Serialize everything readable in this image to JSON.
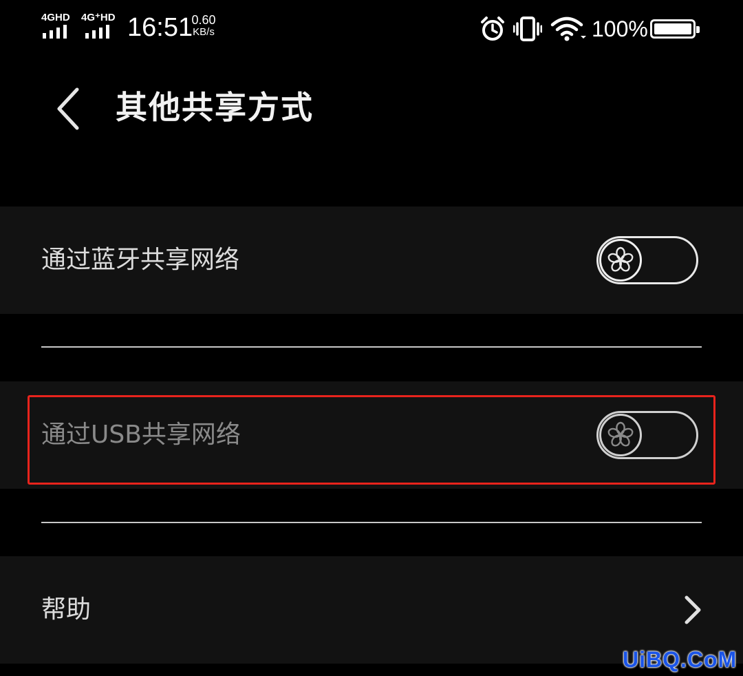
{
  "status_bar": {
    "sim1_label": "4GHD",
    "sim2_label": "4G⁺HD",
    "time": "16:51",
    "net_speed_value": "0.60",
    "net_speed_unit": "KB/s",
    "battery_percent": "100%",
    "battery_level": 1.0,
    "icons": [
      "signal-icon",
      "signal-icon",
      "alarm-icon",
      "vibrate-icon",
      "wifi-icon",
      "battery-icon"
    ]
  },
  "header": {
    "back_icon": "chevron-left-icon",
    "title": "其他共享方式"
  },
  "settings": {
    "bluetooth": {
      "label": "通过蓝牙共享网络",
      "enabled": false
    },
    "usb": {
      "label": "通过USB共享网络",
      "enabled": false,
      "disabled": true
    },
    "help": {
      "label": "帮助",
      "icon": "chevron-right-icon"
    }
  },
  "annotation": {
    "highlight_color": "#e8231c"
  },
  "watermark": {
    "text": "UiBQ.CoM",
    "color": "#1a54e8"
  }
}
